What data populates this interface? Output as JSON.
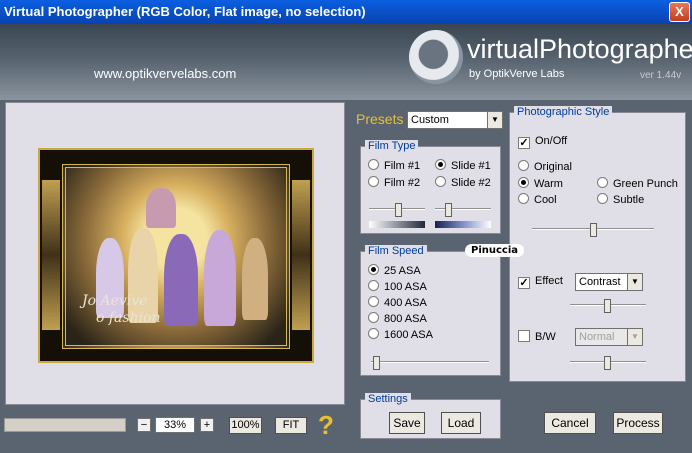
{
  "window": {
    "title": "Virtual Photographer (RGB Color, Flat image, no selection)",
    "close": "X"
  },
  "header": {
    "url": "www.optikvervelabs.com",
    "logo_text": "virtualPhotographer",
    "logo_by": "by OptikVerve Labs",
    "version": "ver 1.44v"
  },
  "preview": {
    "caption_line1": "Jo Aevive",
    "caption_line2": "o fashion"
  },
  "bottom": {
    "zoom_minus": "−",
    "zoom_value": "33%",
    "zoom_plus": "+",
    "btn_100": "100%",
    "btn_fit": "FIT",
    "help": "?"
  },
  "presets": {
    "label": "Presets",
    "selected": "Custom"
  },
  "film_type": {
    "title": "Film Type",
    "options": [
      {
        "label": "Film #1",
        "checked": false
      },
      {
        "label": "Slide #1",
        "checked": true
      },
      {
        "label": "Film #2",
        "checked": false
      },
      {
        "label": "Slide #2",
        "checked": false
      }
    ]
  },
  "film_speed": {
    "title": "Film Speed",
    "options": [
      {
        "label": "25 ASA",
        "checked": true
      },
      {
        "label": "100 ASA",
        "checked": false
      },
      {
        "label": "400 ASA",
        "checked": false
      },
      {
        "label": "800 ASA",
        "checked": false
      },
      {
        "label": "1600 ASA",
        "checked": false
      }
    ]
  },
  "settings": {
    "title": "Settings",
    "save": "Save",
    "load": "Load"
  },
  "style": {
    "title": "Photographic Style",
    "onoff": "On/Off",
    "options": [
      {
        "label": "Original",
        "checked": false
      },
      {
        "label": "Warm",
        "checked": true
      },
      {
        "label": "Green Punch",
        "checked": false
      },
      {
        "label": "Cool",
        "checked": false
      },
      {
        "label": "Subtle",
        "checked": false
      }
    ],
    "effect_label": "Effect",
    "effect_value": "Contrast",
    "bw_label": "B/W",
    "bw_value": "Normal"
  },
  "actions": {
    "cancel": "Cancel",
    "process": "Process"
  },
  "watermark": "Pinuccia",
  "colors": {
    "title_bar": "#0a5fe0",
    "accent_gold": "#e8c030",
    "panel_title": "#003c9c",
    "panel_bg": "#e0dee6"
  }
}
